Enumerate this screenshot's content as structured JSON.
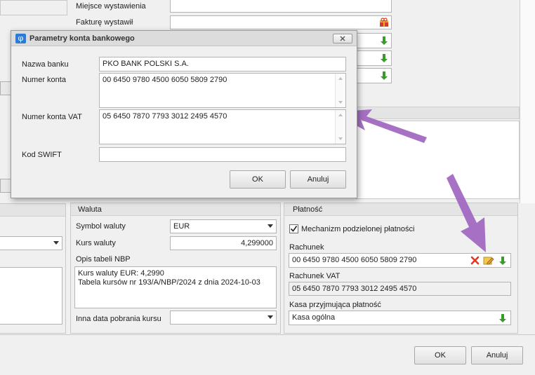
{
  "top": {
    "issue_place_label": "Miejsce wystawienia",
    "issuer_label": "Fakturę wystawił"
  },
  "currency": {
    "heading": "Waluta",
    "symbol_label": "Symbol waluty",
    "symbol_value": "EUR",
    "rate_label": "Kurs waluty",
    "rate_value": "4,299000",
    "nbp_label": "Opis tabeli NBP",
    "nbp_line1": "Kurs waluty EUR: 4,2990",
    "nbp_line2": "Tabela kursów nr 193/A/NBP/2024 z dnia 2024-10-03",
    "other_date_label": "Inna data pobrania kursu",
    "other_date_value": ""
  },
  "payment": {
    "heading": "Płatność",
    "split_label": "Mechanizm podzielonej płatności",
    "split_checked": true,
    "account_label": "Rachunek",
    "account_value": "00 6450 9780 4500 6050 5809 2790",
    "vat_label": "Rachunek VAT",
    "vat_value": "05 6450 7870 7793 3012 2495 4570",
    "cash_label": "Kasa przyjmująca płatność",
    "cash_value": "Kasa ogólna"
  },
  "footer": {
    "ok_label": "OK",
    "cancel_label": "Anuluj"
  },
  "dialog": {
    "title": "Parametry konta bankowego",
    "bank_name_label": "Nazwa banku",
    "bank_name_value": "PKO BANK POLSKI S.A.",
    "account_label": "Numer konta",
    "account_value": "00 6450 9780 4500 6050 5809 2790",
    "vat_label": "Numer konta VAT",
    "vat_value": "05 6450 7870 7793 3012 2495 4570",
    "swift_label": "Kod SWIFT",
    "swift_value": "",
    "ok_label": "OK",
    "cancel_label": "Anuluj"
  },
  "colors": {
    "annotation_arrow": "#a066c0",
    "dialog_title_bg": "#dcdcdc",
    "green_icon": "#3a9b2c",
    "red_icon": "#d93a2b"
  }
}
